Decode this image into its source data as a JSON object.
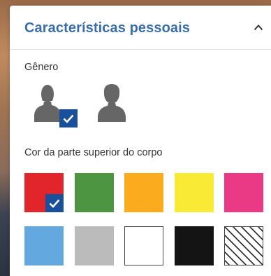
{
  "panel": {
    "title": "Características pessoais",
    "collapse_icon": "chevron-up-icon"
  },
  "gender": {
    "label": "Gênero",
    "options": [
      {
        "icon": "female-person-icon",
        "selected": true
      },
      {
        "icon": "male-person-icon",
        "selected": false
      }
    ]
  },
  "upper_body_color": {
    "label": "Cor da parte superior do corpo",
    "swatches": [
      {
        "color": "#e2242b",
        "selected": true
      },
      {
        "color": "#4e9542",
        "selected": false
      },
      {
        "color": "#fbac1e",
        "selected": false
      },
      {
        "color": "#f9eb35",
        "selected": false
      },
      {
        "color": "#ea3a86",
        "selected": false
      },
      {
        "color": "#63a9e0",
        "selected": false
      },
      {
        "color": "#bbbbbb",
        "selected": false
      },
      {
        "color": "#ffffff",
        "selected": false
      },
      {
        "color": "#141414",
        "selected": false
      },
      {
        "color": "pattern-diagonal-stripes",
        "selected": false
      }
    ]
  },
  "colors": {
    "accent": "#3a6ea9",
    "check_badge": "#1a4f9c",
    "icon_gray": "#666666"
  }
}
